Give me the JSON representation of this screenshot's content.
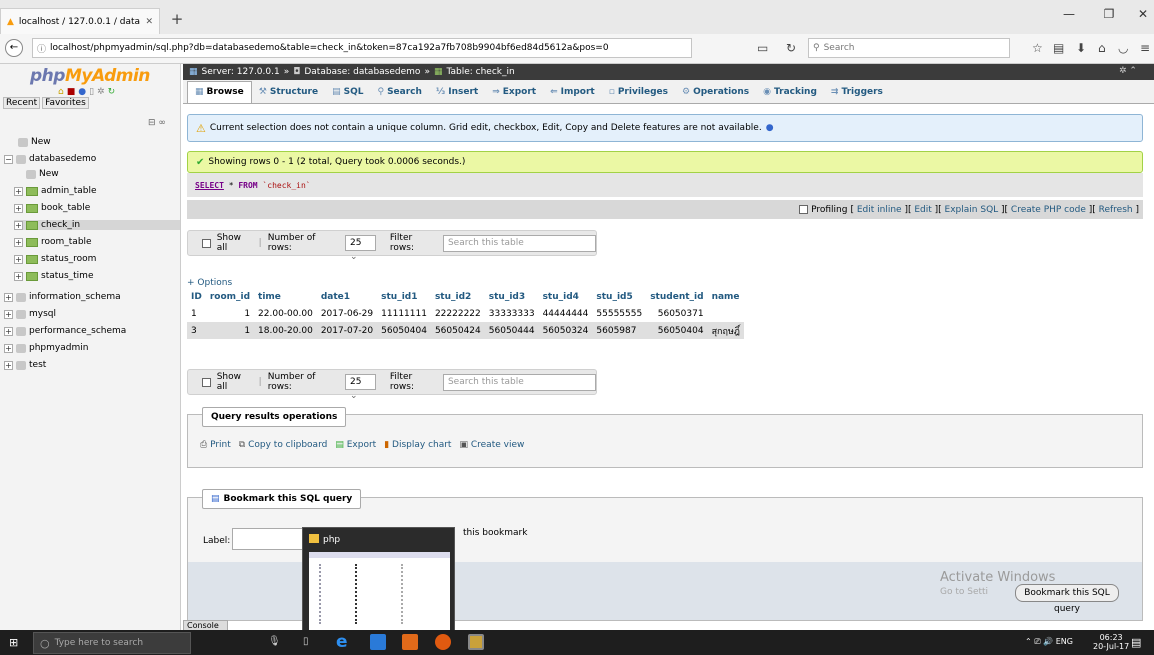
{
  "browser": {
    "tab_title": "localhost / 127.0.0.1 / datab:",
    "url": "localhost/phpmyadmin/sql.php?db=databasedemo&table=check_in&token=87ca192a7fb708b9904bf6ed84d5612a&pos=0",
    "search_placeholder": "Search"
  },
  "sidebar": {
    "logo_php": "php",
    "logo_myadmin": "MyAdmin",
    "recent": "Recent",
    "favorites": "Favorites",
    "new": "New",
    "database": "databasedemo",
    "db_new": "New",
    "tables": [
      "admin_table",
      "book_table",
      "check_in",
      "room_table",
      "status_room",
      "status_time"
    ],
    "other_dbs": [
      "information_schema",
      "mysql",
      "performance_schema",
      "phpmyadmin",
      "test"
    ]
  },
  "breadcrumb": {
    "server": "Server: 127.0.0.1",
    "database": "Database: databasedemo",
    "table": "Table: check_in"
  },
  "tabs": [
    "Browse",
    "Structure",
    "SQL",
    "Search",
    "Insert",
    "Export",
    "Import",
    "Privileges",
    "Operations",
    "Tracking",
    "Triggers"
  ],
  "messages": {
    "warning": "Current selection does not contain a unique column. Grid edit, checkbox, Edit, Copy and Delete features are not available.",
    "success": "Showing rows 0 - 1 (2 total, Query took 0.0006 seconds.)"
  },
  "sql": {
    "select": "SELECT",
    "star": " * ",
    "from": "FROM",
    "table": " `check_in`"
  },
  "profiling": {
    "label": "Profiling",
    "links": [
      "Edit inline",
      "Edit",
      "Explain SQL",
      "Create PHP code",
      "Refresh"
    ]
  },
  "nav": {
    "show_all": "Show all",
    "rows_label": "Number of rows:",
    "rows_value": "25",
    "filter_label": "Filter rows:",
    "filter_placeholder": "Search this table"
  },
  "results": {
    "options": "+ Options",
    "columns": [
      "ID",
      "room_id",
      "time",
      "date1",
      "stu_id1",
      "stu_id2",
      "stu_id3",
      "stu_id4",
      "stu_id5",
      "student_id",
      "name"
    ],
    "rows": [
      [
        "1",
        "1",
        "22.00-00.00",
        "2017-06-29",
        "11111111",
        "22222222",
        "33333333",
        "44444444",
        "55555555",
        "56050371",
        ""
      ],
      [
        "3",
        "1",
        "18.00-20.00",
        "2017-07-20",
        "56050404",
        "56050424",
        "56050444",
        "56050324",
        "5605987",
        "56050404",
        "สุกฤษฎิ์"
      ]
    ]
  },
  "ops": {
    "title": "Query results operations",
    "print": "Print",
    "copy": "Copy to clipboard",
    "export": "Export",
    "chart": "Display chart",
    "view": "Create view"
  },
  "bookmark": {
    "title": "Bookmark this SQL query",
    "label": "Label:",
    "note": "this bookmark",
    "button": "Bookmark this SQL query"
  },
  "popup": {
    "title": "php"
  },
  "console": "Console",
  "watermark": {
    "line1": "Activate Windows",
    "line2": "Go to Setti"
  },
  "taskbar": {
    "search_placeholder": "Type here to search",
    "lang": "ENG",
    "time": "06:23",
    "date": "20-Jul-17"
  }
}
